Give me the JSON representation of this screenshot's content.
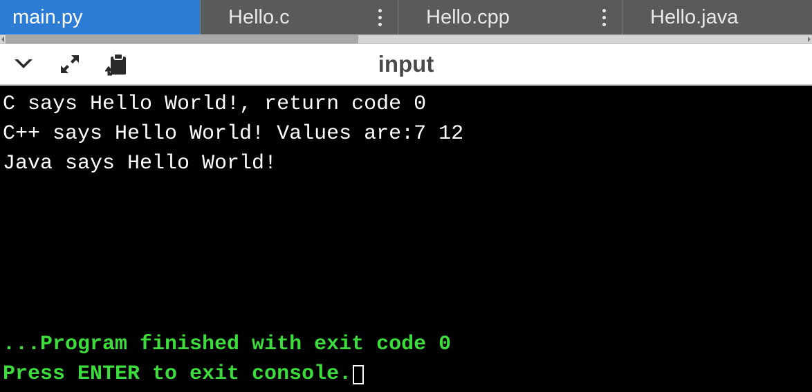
{
  "tabs": [
    {
      "label": "main.py",
      "active": true,
      "has_menu": false
    },
    {
      "label": "Hello.c",
      "active": false,
      "has_menu": true
    },
    {
      "label": "Hello.cpp",
      "active": false,
      "has_menu": true
    },
    {
      "label": "Hello.java",
      "active": false,
      "has_menu": false
    }
  ],
  "toolbar": {
    "title": "input"
  },
  "console": {
    "output_lines": [
      "C says Hello World!, return code 0",
      "C++ says Hello World! Values are:7 12",
      "Java says Hello World!"
    ],
    "exit_lines": [
      "...Program finished with exit code 0",
      "Press ENTER to exit console."
    ]
  }
}
